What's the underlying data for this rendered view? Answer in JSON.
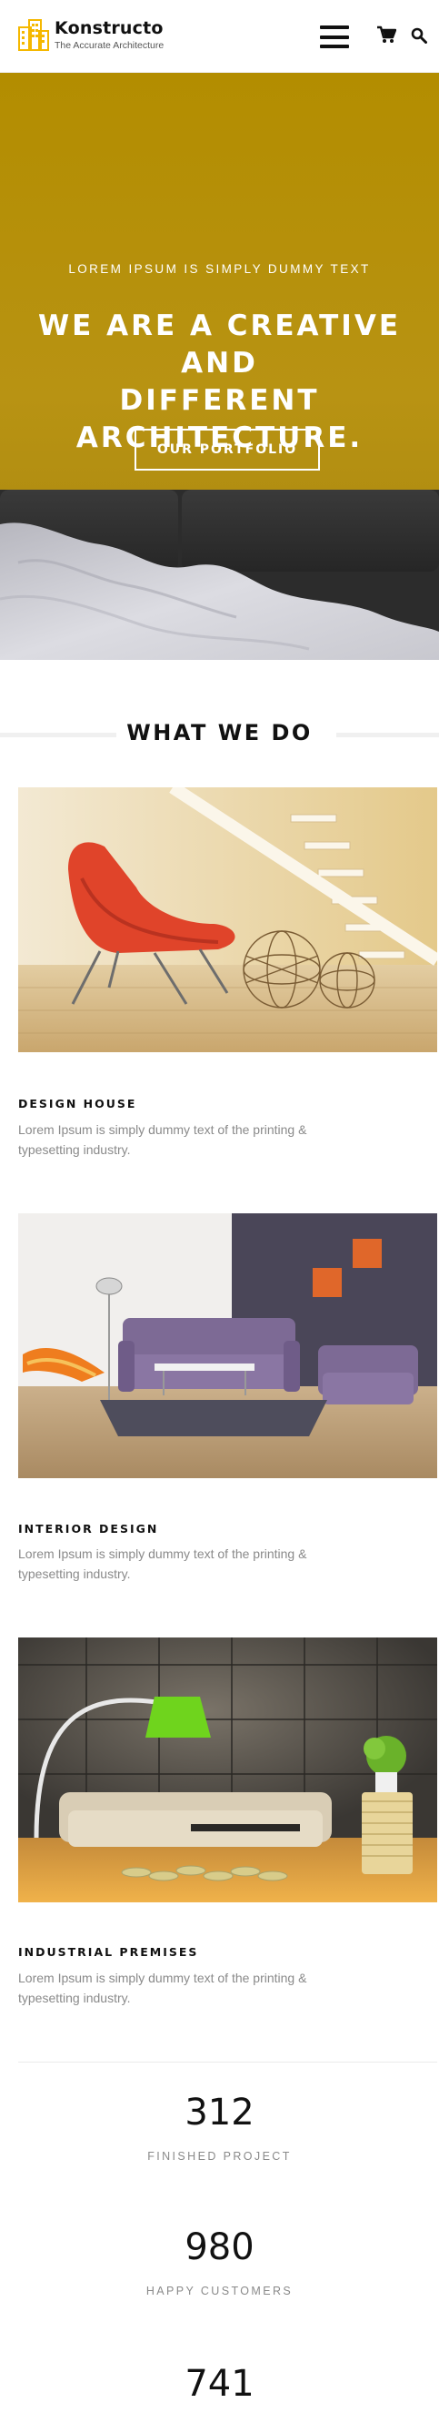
{
  "header": {
    "brand": "Konstructo",
    "tagline": "The Accurate Architecture"
  },
  "hero": {
    "subtitle": "LOREM IPSUM IS SIMPLY DUMMY TEXT",
    "title_line1": "WE ARE A CREATIVE AND",
    "title_line2": "DIFFERENT ARCHITECTURE.",
    "button_label": "OUR PORTFOLIO"
  },
  "services": {
    "heading": "WHAT WE DO",
    "items": [
      {
        "title": "DESIGN HOUSE",
        "text_line1": "Lorem Ipsum is simply dummy text of the printing &",
        "text_line2": "typesetting industry."
      },
      {
        "title": "INTERIOR DESIGN",
        "text_line1": "Lorem Ipsum is simply dummy text of the printing &",
        "text_line2": "typesetting industry."
      },
      {
        "title": "INDUSTRIAL PREMISES",
        "text_line1": "Lorem Ipsum is simply dummy text of the printing &",
        "text_line2": "typesetting industry."
      }
    ]
  },
  "counters": [
    {
      "value": "312",
      "label": "FINISHED PROJECT"
    },
    {
      "value": "980",
      "label": "HAPPY CUSTOMERS"
    },
    {
      "value": "741",
      "label": ""
    }
  ],
  "colors": {
    "accent": "#f5b800",
    "hero_bg": "#b38d00",
    "text_muted": "#8a8a8a"
  },
  "icons": [
    "logo-building-icon",
    "menu-icon",
    "cart-icon",
    "search-icon"
  ]
}
